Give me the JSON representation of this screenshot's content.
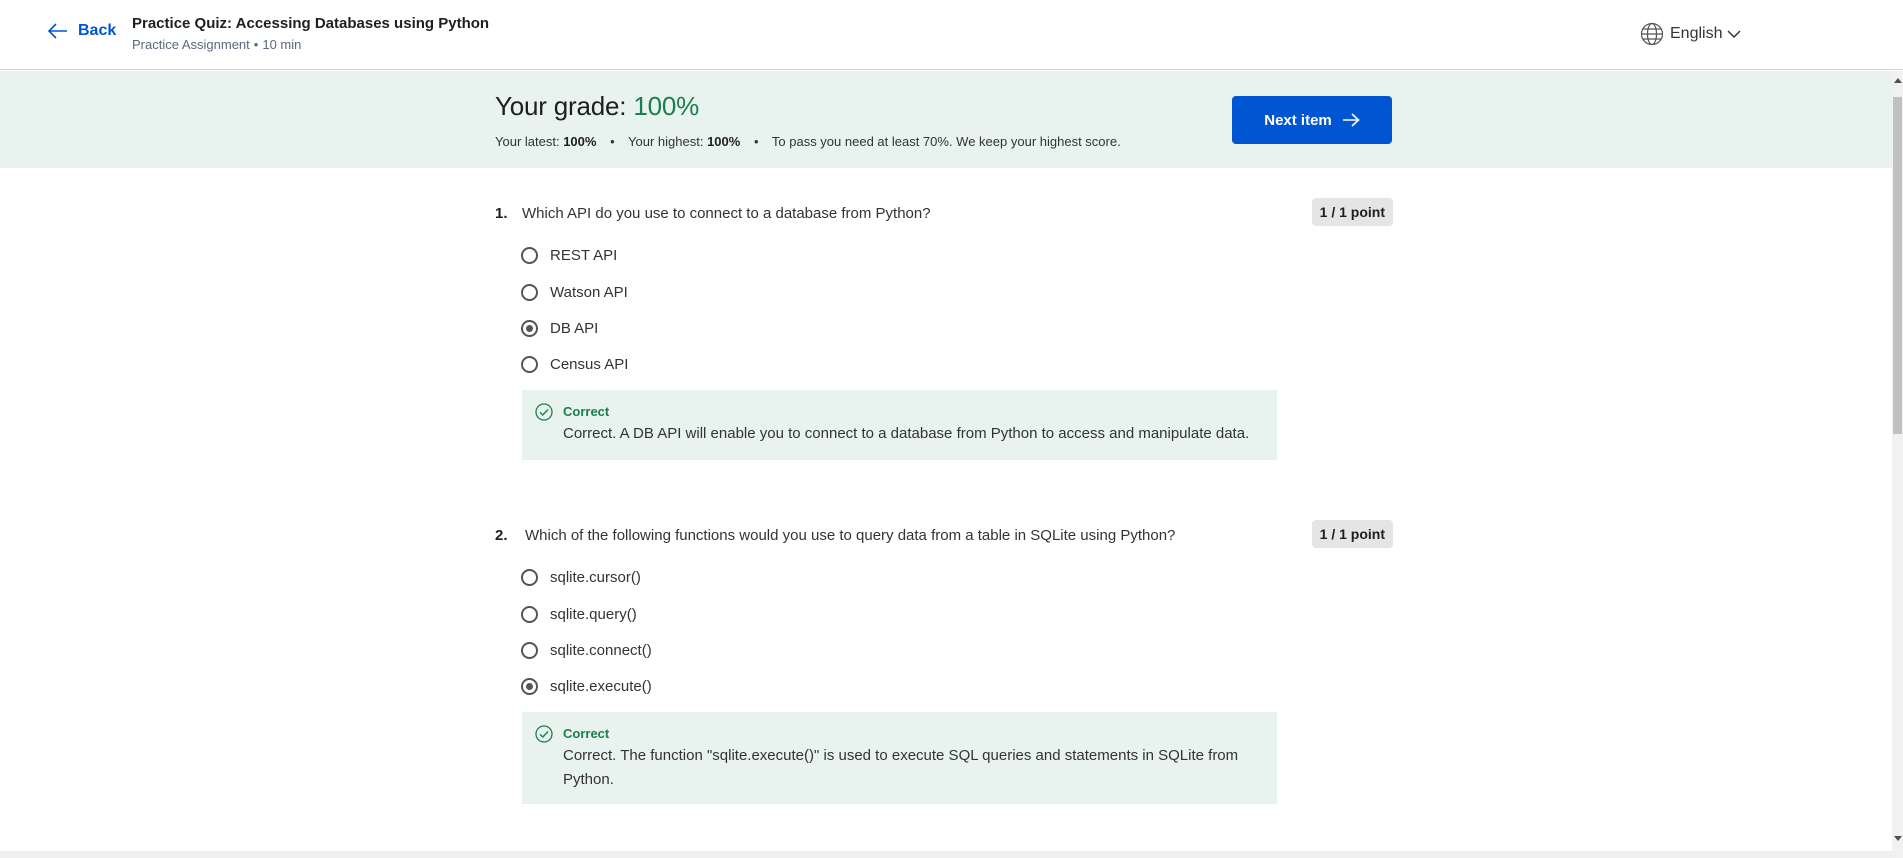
{
  "header": {
    "back_label": "Back",
    "title": "Practice Quiz: Accessing Databases using Python",
    "subtitle_type": "Practice Assignment",
    "subtitle_duration": "10 min",
    "language": "English"
  },
  "grade": {
    "label": "Your grade:",
    "value": "100%",
    "latest_label": "Your latest:",
    "latest_value": "100%",
    "highest_label": "Your highest:",
    "highest_value": "100%",
    "pass_note": "To pass you need at least 70%. We keep your highest score.",
    "next_button": "Next item"
  },
  "questions": [
    {
      "number": "1.",
      "text": "Which API do you use to connect to a database from Python?",
      "points": "1 / 1 point",
      "options": [
        "REST API",
        "Watson API",
        "DB API",
        "Census API"
      ],
      "selected": "DB API",
      "feedback_label": "Correct",
      "feedback_text": "Correct. A DB API will enable you to connect to a database from Python to access and manipulate data."
    },
    {
      "number": "2.",
      "text": "Which of the following functions would you use to query data from a table in SQLite using Python?",
      "points": "1 / 1 point",
      "options": [
        "sqlite.cursor()",
        "sqlite.query()",
        "sqlite.connect()",
        "sqlite.execute()"
      ],
      "selected": "sqlite.execute()",
      "feedback_label": "Correct",
      "feedback_text": "Correct. The function \"sqlite.execute()\" is used to execute SQL queries and statements in SQLite from Python."
    }
  ],
  "colors": {
    "accent": "#0056d2",
    "success": "#1b7f4c",
    "banner_bg": "#e8f2ee"
  }
}
